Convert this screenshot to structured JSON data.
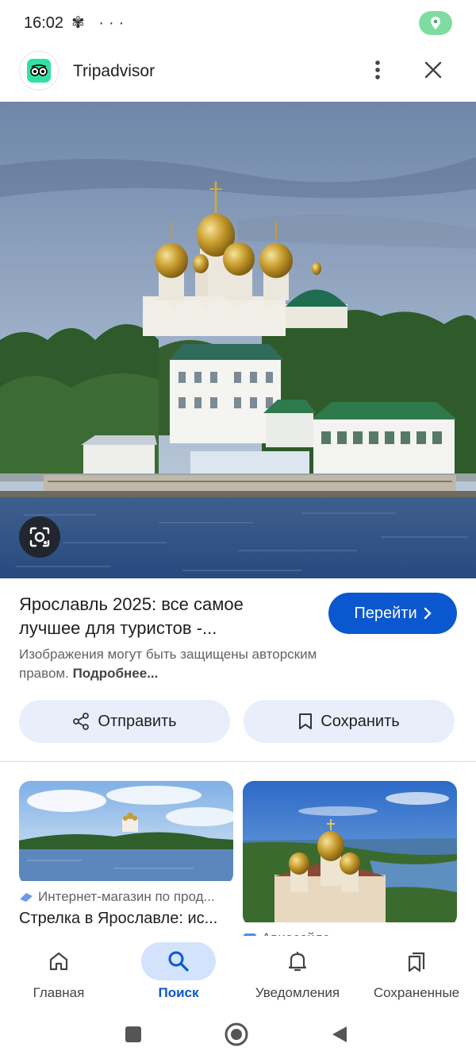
{
  "status_bar": {
    "time": "16:02",
    "icons": "✾ ···"
  },
  "header": {
    "site_name": "Tripadvisor"
  },
  "result": {
    "title": "Ярославль 2025: все самое лучшее для туристов -...",
    "visit_label": "Перейти",
    "copyright_text": "Изображения могут быть защищены авторским правом.",
    "copyright_more": "Подробнее..."
  },
  "actions": {
    "share_label": "Отправить",
    "save_label": "Сохранить"
  },
  "related": [
    {
      "source": "Интернет-магазин по прод...",
      "title": "Стрелка в Ярославле: ис..."
    },
    {
      "source": "Авиасейлс",
      "title": ""
    }
  ],
  "bottom_nav": [
    {
      "label": "Главная",
      "icon": "home-icon",
      "active": false
    },
    {
      "label": "Поиск",
      "icon": "search-icon",
      "active": true
    },
    {
      "label": "Уведомления",
      "icon": "bell-icon",
      "active": false
    },
    {
      "label": "Сохраненные",
      "icon": "saved-icon",
      "active": false
    }
  ],
  "colors": {
    "accent": "#0b57d0",
    "pill": "#7fdca0",
    "tripadvisor": "#34e0a1"
  }
}
